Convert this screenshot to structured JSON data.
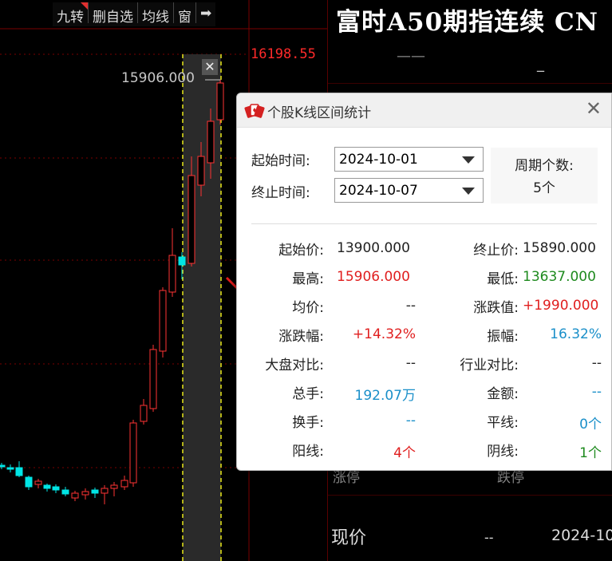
{
  "toolbar": {
    "items": [
      "九转",
      "删自选",
      "均线",
      "窗",
      "➡"
    ]
  },
  "chart": {
    "price_axis_label": "16198.55",
    "high_marker_label": "15906.000",
    "close_glyph": "✕",
    "colors": {
      "up": "#ff3333",
      "down": "#00e5e5",
      "grid": "#7a0000",
      "selection": "#e8e81a"
    }
  },
  "right_panel": {
    "title": "富时A50期指连续 CN",
    "dash1": "——",
    "dash2": "_",
    "footer_left": "涨停",
    "footer_right": "跌停",
    "price_label": "现价",
    "price_value": "--",
    "price_date": "2024-10"
  },
  "dialog": {
    "title": "个股K线区间统计",
    "close_glyph": "✕",
    "start_time_label": "起始时间:",
    "start_time_value": "2024-10-01",
    "end_time_label": "终止时间:",
    "end_time_value": "2024-10-07",
    "period_count_label": "周期个数:",
    "period_count_value": "5个",
    "stats": {
      "start_price_label": "起始价:",
      "start_price_value": "13900.000",
      "end_price_label": "终止价:",
      "end_price_value": "15890.000",
      "high_label": "最高:",
      "high_value": "15906.000",
      "low_label": "最低:",
      "low_value": "13637.000",
      "avg_label": "均价:",
      "avg_value": "--",
      "change_label": "涨跌值:",
      "change_value": "+1990.000",
      "change_pct_label": "涨跌幅:",
      "change_pct_value": "+14.32%",
      "amplitude_label": "振幅:",
      "amplitude_value": "16.32%",
      "market_compare_label": "大盘对比:",
      "market_compare_value": "--",
      "industry_compare_label": "行业对比:",
      "industry_compare_value": "--",
      "volume_label": "总手:",
      "volume_value": "192.07万",
      "amount_label": "金额:",
      "amount_value": "--",
      "turnover_label": "换手:",
      "turnover_value": "--",
      "flat_label": "平线:",
      "flat_value": "0个",
      "up_lines_label": "阳线:",
      "up_lines_value": "4个",
      "down_lines_label": "阴线:",
      "down_lines_value": "1个"
    }
  }
}
